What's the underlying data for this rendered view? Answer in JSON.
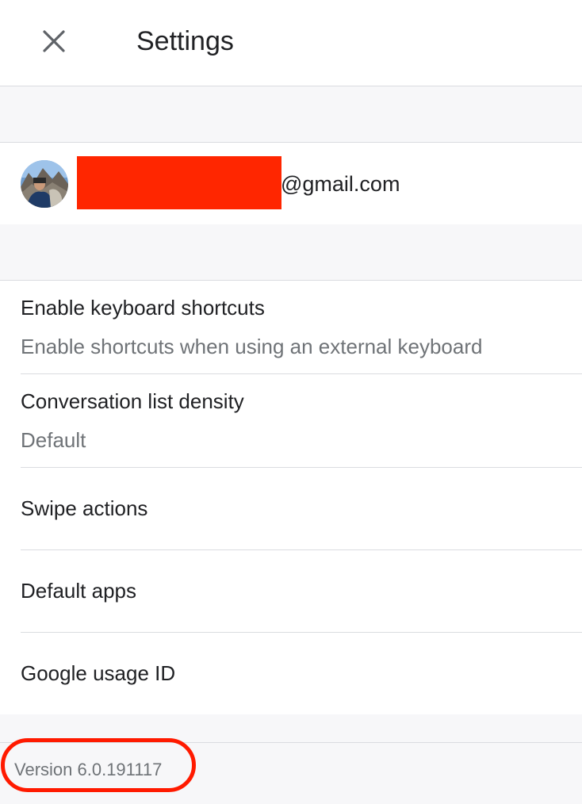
{
  "header": {
    "title": "Settings",
    "close_icon": "close-icon"
  },
  "account": {
    "email_suffix": "@gmail.com",
    "avatar_icon": "avatar-photo",
    "redaction_color": "#ff2600"
  },
  "settings": {
    "items": [
      {
        "label": "Enable keyboard shortcuts",
        "sub": "Enable shortcuts when using an external keyboard"
      },
      {
        "label": "Conversation list density",
        "sub": "Default"
      },
      {
        "label": "Swipe actions"
      },
      {
        "label": "Default apps"
      },
      {
        "label": "Google usage ID"
      }
    ]
  },
  "footer": {
    "version": "Version 6.0.191117",
    "highlight_color": "#ff1a00"
  }
}
